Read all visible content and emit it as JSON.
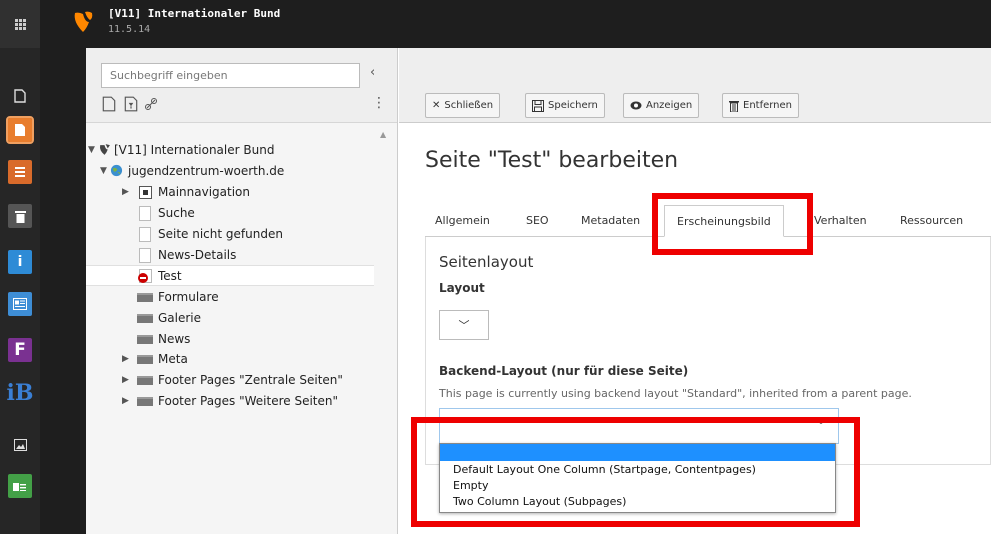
{
  "topbar": {
    "site_title": "[V11] Internationaler Bund",
    "version": "11.5.14"
  },
  "module_menu": {
    "items": [
      {
        "name": "page-icon",
        "color": "#262626"
      },
      {
        "name": "page-module-icon",
        "color": "#e87d2d"
      },
      {
        "name": "list-icon",
        "color": "#d96b2b"
      },
      {
        "name": "trash-icon",
        "color": "#555555"
      },
      {
        "name": "info-icon",
        "color": "#2e8bd6"
      },
      {
        "name": "news-icon",
        "color": "#3e8ed6"
      },
      {
        "name": "form-icon",
        "color": "#7a3191"
      },
      {
        "name": "ib-logo-icon",
        "color": "#262626"
      },
      {
        "name": "image-icon",
        "color": "#262626"
      },
      {
        "name": "layout-icon",
        "color": "#43a047"
      }
    ],
    "ib_label": "iB",
    "form_label": "F"
  },
  "pagetree": {
    "search_placeholder": "Suchbegriff eingeben",
    "root": "[V11] Internationaler Bund",
    "site": "jugendzentrum-woerth.de",
    "items": [
      {
        "label": "Mainnavigation"
      },
      {
        "label": "Suche"
      },
      {
        "label": "Seite nicht gefunden"
      },
      {
        "label": "News-Details"
      },
      {
        "label": "Test"
      },
      {
        "label": "Formulare"
      },
      {
        "label": "Galerie"
      },
      {
        "label": "News"
      },
      {
        "label": "Meta"
      },
      {
        "label": "Footer Pages \"Zentrale Seiten\""
      },
      {
        "label": "Footer Pages \"Weitere Seiten\""
      }
    ]
  },
  "docheader": {
    "close": "Schließen",
    "save": "Speichern",
    "view": "Anzeigen",
    "delete": "Entfernen"
  },
  "editor": {
    "title": "Seite \"Test\" bearbeiten",
    "tabs": [
      "Allgemein",
      "SEO",
      "Metadaten",
      "Erscheinungsbild",
      "Verhalten",
      "Ressourcen"
    ],
    "active_tab": "Erscheinungsbild",
    "section": "Seitenlayout",
    "layout_label": "Layout",
    "layout_value": "",
    "backend_layout_label": "Backend-Layout (nur für diese Seite)",
    "backend_layout_hint": "This page is currently using backend layout \"Standard\", inherited from a parent page.",
    "backend_layout_value": "",
    "backend_layout_options": [
      "",
      "Default Layout One Column (Startpage, Contentpages)",
      "Empty",
      "Two Column Layout (Subpages)"
    ]
  },
  "colors": {
    "highlight": "#ee0000",
    "selection": "#1e90ff"
  }
}
